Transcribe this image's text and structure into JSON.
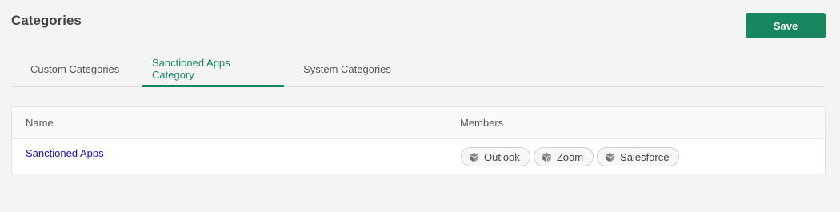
{
  "header": {
    "title": "Categories",
    "save_label": "Save"
  },
  "tabs": [
    {
      "label": "Custom Categories",
      "active": false
    },
    {
      "label": "Sanctioned Apps Category",
      "active": true
    },
    {
      "label": "System Categories",
      "active": false
    }
  ],
  "table": {
    "columns": {
      "name": "Name",
      "members": "Members"
    },
    "rows": [
      {
        "name": "Sanctioned Apps",
        "members": [
          {
            "label": "Outlook",
            "icon": "cube-icon"
          },
          {
            "label": "Zoom",
            "icon": "cube-icon"
          },
          {
            "label": "Salesforce",
            "icon": "cube-icon"
          }
        ]
      }
    ]
  },
  "colors": {
    "accent": "#188760",
    "link": "#1a0dcc"
  }
}
